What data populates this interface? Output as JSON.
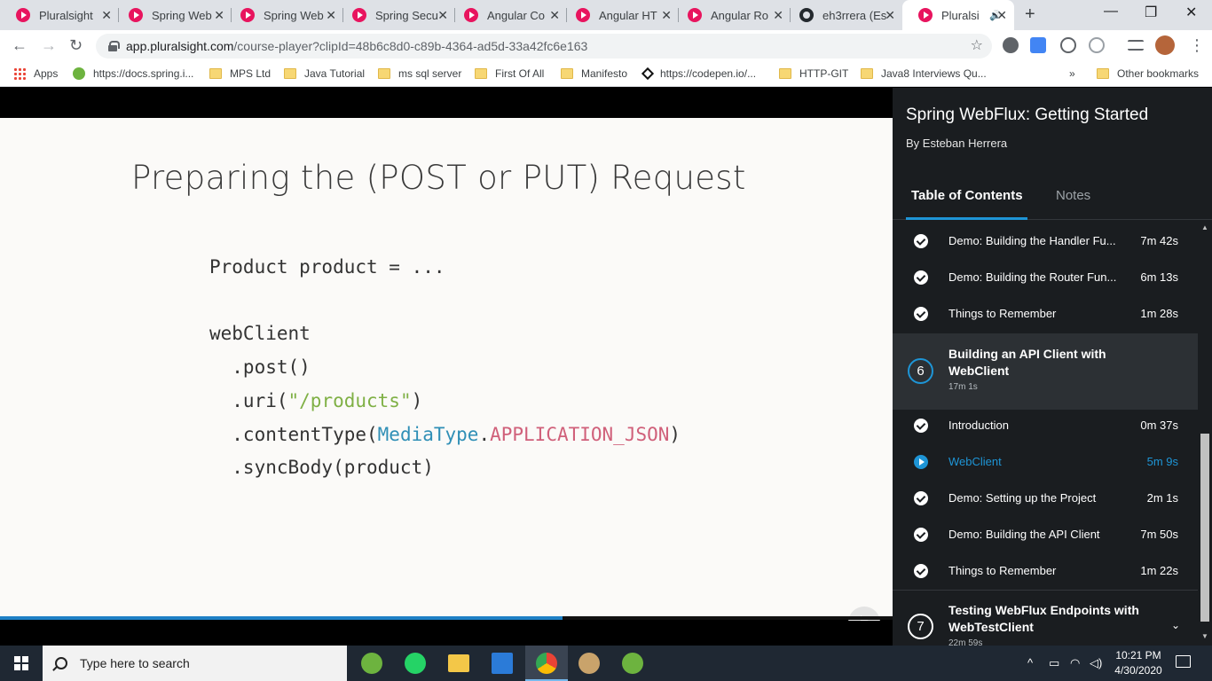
{
  "browser": {
    "tabs": [
      {
        "title": "Pluralsight",
        "icon": "pluralsight-icon"
      },
      {
        "title": "Spring Web",
        "icon": "pluralsight-icon"
      },
      {
        "title": "Spring Web",
        "icon": "pluralsight-icon"
      },
      {
        "title": "Spring Secu",
        "icon": "pluralsight-icon"
      },
      {
        "title": "Angular Co",
        "icon": "pluralsight-icon"
      },
      {
        "title": "Angular HT",
        "icon": "pluralsight-icon"
      },
      {
        "title": "Angular Ro",
        "icon": "pluralsight-icon"
      },
      {
        "title": "eh3rrera (Es",
        "icon": "github-icon"
      },
      {
        "title": "Pluralsi",
        "icon": "pluralsight-icon",
        "active": true
      }
    ],
    "url_host": "app.pluralsight.com",
    "url_rest": "/course-player?clipId=48b6c8d0-c89b-4364-ad5d-33a42fc6e163",
    "bookmarks": [
      {
        "label": "Apps"
      },
      {
        "label": "https://docs.spring.i..."
      },
      {
        "label": "MPS Ltd"
      },
      {
        "label": "Java Tutorial"
      },
      {
        "label": "ms sql server"
      },
      {
        "label": "First Of All"
      },
      {
        "label": "Manifesto"
      },
      {
        "label": "https://codepen.io/..."
      },
      {
        "label": "HTTP-GIT"
      },
      {
        "label": "Java8 Interviews Qu..."
      },
      {
        "label": "»"
      },
      {
        "label": "Other bookmarks"
      }
    ]
  },
  "slide": {
    "title": "Preparing the (POST or PUT) Request",
    "code": {
      "line1": "Product product = ...",
      "line2": "webClient",
      "line3": "  .post()",
      "line4_a": "  .uri(",
      "line4_str": "\"/products\"",
      "line4_b": ")",
      "line5_a": "  .contentType(",
      "line5_cls": "MediaType",
      "line5_dot": ".",
      "line5_cst": "APPLICATION_JSON",
      "line5_b": ")",
      "line6": "  .syncBody(product)"
    },
    "progress_percent": 63
  },
  "panel": {
    "course_title": "Spring WebFlux: Getting Started",
    "author": "By Esteban Herrera",
    "tab_toc": "Table of Contents",
    "tab_notes": "Notes",
    "clips_prev": [
      {
        "name": "Demo: Building the Handler Fu...",
        "dur": "7m 42s"
      },
      {
        "name": "Demo: Building the Router Fun...",
        "dur": "6m 13s"
      },
      {
        "name": "Things to Remember",
        "dur": "1m 28s"
      }
    ],
    "module6": {
      "num": "6",
      "title": "Building an API Client with WebClient",
      "dur": "17m 1s"
    },
    "clips_module6": [
      {
        "name": "Introduction",
        "dur": "0m 37s",
        "state": "done"
      },
      {
        "name": "WebClient",
        "dur": "5m 9s",
        "state": "playing"
      },
      {
        "name": "Demo: Setting up the Project",
        "dur": "2m 1s",
        "state": "done"
      },
      {
        "name": "Demo: Building the API Client",
        "dur": "7m 50s",
        "state": "done"
      },
      {
        "name": "Things to Remember",
        "dur": "1m 22s",
        "state": "done"
      }
    ],
    "module7": {
      "num": "7",
      "title": "Testing WebFlux Endpoints with WebTestClient",
      "dur": "22m 59s"
    }
  },
  "taskbar": {
    "search_placeholder": "Type here to search",
    "time": "10:21 PM",
    "date": "4/30/2020"
  },
  "colors": {
    "accent": "#1e95d6",
    "pluralsight": "#e8145e",
    "panel_bg": "#1a1d20"
  }
}
